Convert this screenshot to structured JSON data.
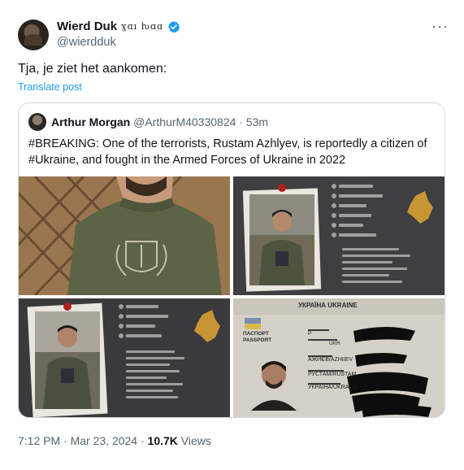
{
  "author": {
    "display_name": "Wierd Duk",
    "name_flourish": "ɣɑı ƕɑɑ",
    "handle": "@wierdduk"
  },
  "tweet": {
    "text": "Tja, je ziet het aankomen:",
    "translate_label": "Translate post",
    "more_label": "···"
  },
  "quote": {
    "author_name": "Arthur Morgan",
    "author_handle": "@ArthurM40330824",
    "separator": "·",
    "time": "53m",
    "text": "#BREAKING: One of the terrorists, Rustam Azhlyev, is  reportedly a citizen of #Ukraine, and fought in the Armed Forces of Ukraine in 2022"
  },
  "media": {
    "passport_header": "УКРАЇНА  UKRAINE",
    "passport_label_ua": "ПАСПОРТ",
    "passport_label_en": "PASSPORT",
    "passport_type": "P",
    "passport_country": "UKR",
    "passport_surname": "АЖИЄВ/AZHIIEV",
    "passport_given": "РУСТАМ/RUSTAM",
    "passport_nationality": "УКРАЇНА/UKRAINE"
  },
  "footer": {
    "time": "7:12 PM",
    "sep1": "·",
    "date": "Mar 23, 2024",
    "sep2": "·",
    "views_count": "10.7K",
    "views_label": "Views"
  },
  "colors": {
    "accent": "#1d9bf0",
    "secondary_text": "#536471",
    "border": "#cfd9de"
  }
}
